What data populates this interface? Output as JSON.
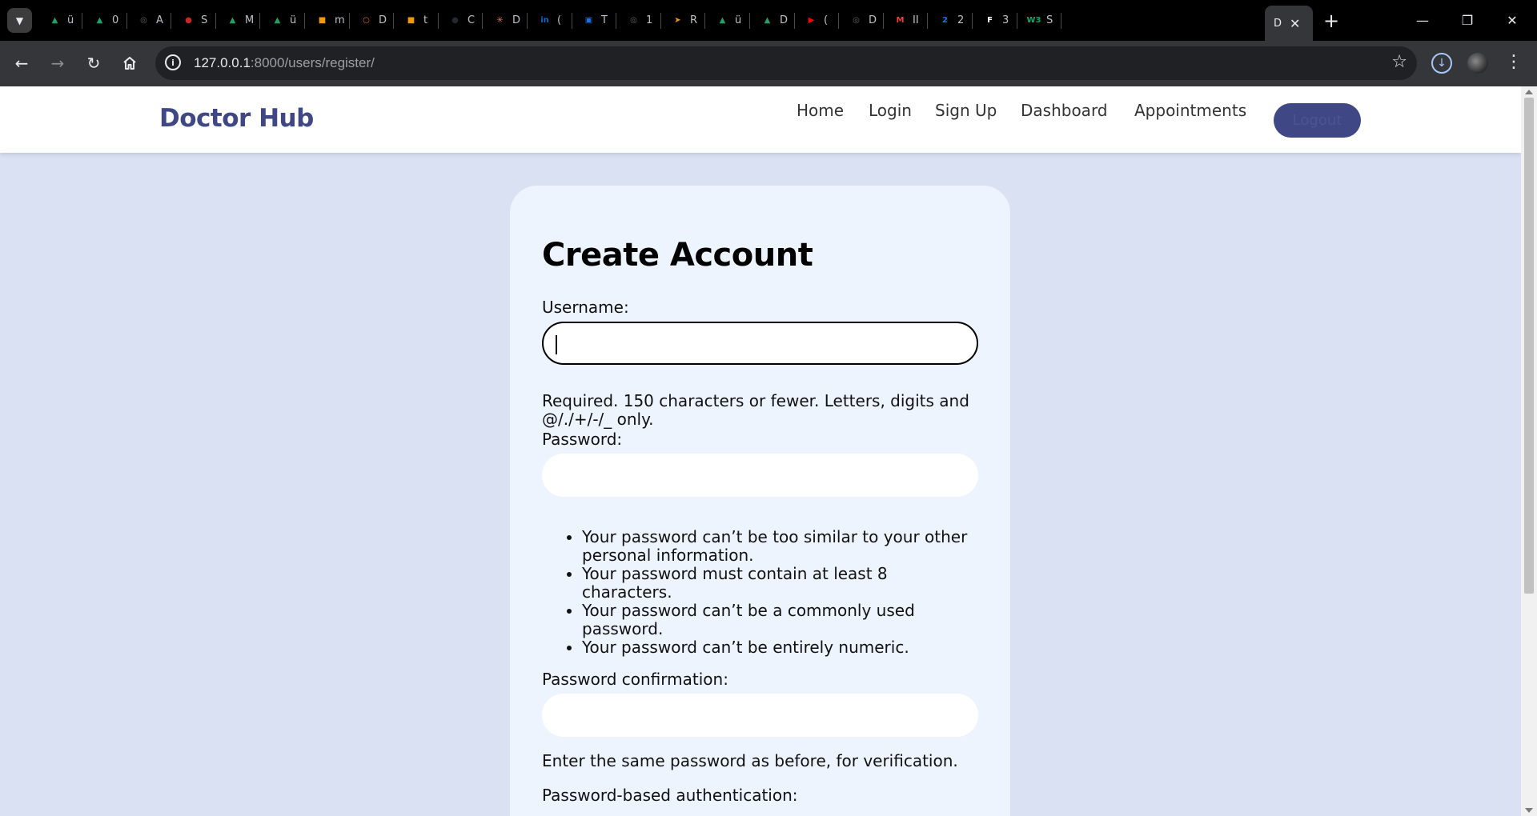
{
  "browser": {
    "tabs": [
      {
        "icon": "google-drive-icon",
        "title": "ü",
        "color": "#1fa463"
      },
      {
        "icon": "google-drive-icon",
        "title": "0",
        "color": "#1fa463"
      },
      {
        "icon": "globe-icon",
        "title": "A",
        "color": "#5f6368"
      },
      {
        "icon": "site-icon",
        "title": "S",
        "color": "#c62828"
      },
      {
        "icon": "google-drive-icon",
        "title": "M",
        "color": "#1fa463"
      },
      {
        "icon": "google-drive-icon",
        "title": "ü",
        "color": "#1fa463"
      },
      {
        "icon": "book-icon",
        "title": "m",
        "color": "#f29900"
      },
      {
        "icon": "ring-icon",
        "title": "D",
        "color": "#e8710a"
      },
      {
        "icon": "book-icon",
        "title": "t",
        "color": "#f29900"
      },
      {
        "icon": "github-icon",
        "title": "C",
        "color": "#24292f"
      },
      {
        "icon": "sparkle-icon",
        "title": "D",
        "color": "#d97757"
      },
      {
        "icon": "linkedin-icon",
        "title": "(",
        "color": "#0a66c2"
      },
      {
        "icon": "meet-icon",
        "title": "T",
        "color": "#1a73e8"
      },
      {
        "icon": "globe-icon",
        "title": "1",
        "color": "#5f6368"
      },
      {
        "icon": "arrow-icon",
        "title": "R",
        "color": "#f29900"
      },
      {
        "icon": "google-drive-icon",
        "title": "ü",
        "color": "#1fa463"
      },
      {
        "icon": "google-drive-icon",
        "title": "D",
        "color": "#1fa463"
      },
      {
        "icon": "youtube-icon",
        "title": "(",
        "color": "#ff0000"
      },
      {
        "icon": "globe-icon",
        "title": "D",
        "color": "#5f6368"
      },
      {
        "icon": "gmail-icon",
        "title": "II",
        "color": "#ea4335"
      },
      {
        "icon": "number-icon",
        "title": "2",
        "color": "#1a73e8"
      },
      {
        "icon": "letter-f-icon",
        "title": "3",
        "color": "#ffffff"
      },
      {
        "icon": "w3schools-icon",
        "title": "S",
        "color": "#04aa6d"
      }
    ],
    "active_tab": {
      "title": "D",
      "close_glyph": "✕"
    },
    "tab_glyphs": [
      "▲",
      "▲",
      "◎",
      "●",
      "▲",
      "▲",
      "■",
      "○",
      "■",
      "●",
      "✳",
      "in",
      "▣",
      "◎",
      "➤",
      "▲",
      "▲",
      "▶",
      "◎",
      "M",
      "2",
      "F",
      "W3"
    ],
    "url_host": "127.0.0.1",
    "url_rest": ":8000/users/register/"
  },
  "site": {
    "brand": "Doctor Hub",
    "nav": {
      "home": "Home",
      "login": "Login",
      "signup": "Sign Up",
      "dashboard": "Dashboard",
      "appointments": "Appointments",
      "logout": "Logout"
    }
  },
  "form": {
    "title": "Create Account",
    "username_label": "Username:",
    "username_value": "",
    "username_help": "Required. 150 characters or fewer. Letters, digits and @/./+/-/_ only.",
    "password_label": "Password:",
    "password_value": "",
    "password_rules": [
      "Your password can’t be too similar to your other personal information.",
      "Your password must contain at least 8 characters.",
      "Your password can’t be a commonly used password.",
      "Your password can’t be entirely numeric."
    ],
    "confirm_label": "Password confirmation:",
    "confirm_value": "",
    "confirm_help": "Enter the same password as before, for verification.",
    "auth_label": "Password-based authentication:"
  },
  "colors": {
    "brand": "#3f4785",
    "page_bg": "#d9e1f2",
    "card_bg": "#eef4fd"
  }
}
